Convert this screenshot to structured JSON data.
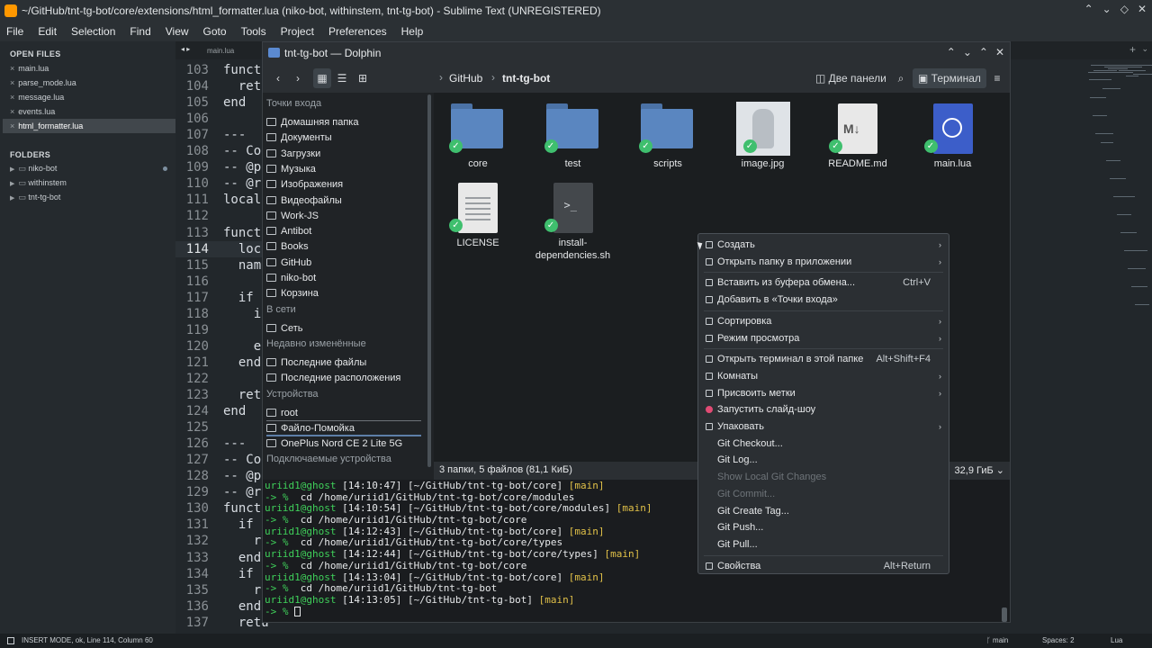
{
  "sublime": {
    "window_title": "~/GitHub/tnt-tg-bot/core/extensions/html_formatter.lua (niko-bot, withinstem, tnt-tg-bot) - Sublime Text (UNREGISTERED)",
    "menu": [
      "File",
      "Edit",
      "Selection",
      "Find",
      "View",
      "Goto",
      "Tools",
      "Project",
      "Preferences",
      "Help"
    ],
    "sidebar": {
      "open_files_title": "OPEN FILES",
      "open_files": [
        "main.lua",
        "parse_mode.lua",
        "message.lua",
        "events.lua",
        "html_formatter.lua"
      ],
      "folders_title": "FOLDERS",
      "folders": [
        "niko-bot",
        "withinstem",
        "tnt-tg-bot"
      ]
    },
    "tab": "main.lua",
    "code": [
      {
        "n": "103",
        "t": "functi"
      },
      {
        "n": "104",
        "t": "  retu"
      },
      {
        "n": "105",
        "t": "end"
      },
      {
        "n": "106",
        "t": ""
      },
      {
        "n": "107",
        "t": "---"
      },
      {
        "n": "108",
        "t": "-- Co"
      },
      {
        "n": "109",
        "t": "-- @pa"
      },
      {
        "n": "110",
        "t": "-- @re"
      },
      {
        "n": "111",
        "t": "local"
      },
      {
        "n": "112",
        "t": ""
      },
      {
        "n": "113",
        "t": "functi"
      },
      {
        "n": "114",
        "t": "  loca"
      },
      {
        "n": "115",
        "t": "  name"
      },
      {
        "n": "116",
        "t": ""
      },
      {
        "n": "117",
        "t": "  if c"
      },
      {
        "n": "118",
        "t": "    if"
      },
      {
        "n": "119",
        "t": ""
      },
      {
        "n": "120",
        "t": "    en"
      },
      {
        "n": "121",
        "t": "  end"
      },
      {
        "n": "122",
        "t": ""
      },
      {
        "n": "123",
        "t": "  retu"
      },
      {
        "n": "124",
        "t": "end"
      },
      {
        "n": "125",
        "t": ""
      },
      {
        "n": "126",
        "t": "---"
      },
      {
        "n": "127",
        "t": "-- Co"
      },
      {
        "n": "128",
        "t": "-- @pa"
      },
      {
        "n": "129",
        "t": "-- @re"
      },
      {
        "n": "130",
        "t": "functi"
      },
      {
        "n": "131",
        "t": "  if c"
      },
      {
        "n": "132",
        "t": "    re"
      },
      {
        "n": "133",
        "t": "  end"
      },
      {
        "n": "134",
        "t": "  if ("
      },
      {
        "n": "135",
        "t": "    re"
      },
      {
        "n": "136",
        "t": "  end"
      },
      {
        "n": "137",
        "t": "  retu"
      }
    ],
    "status": {
      "left": "INSERT MODE, ok, Line 114, Column 60",
      "branch": "main",
      "spaces": "Spaces: 2",
      "syntax": "Lua"
    }
  },
  "dolphin": {
    "title": "tnt-tg-bot — Dolphin",
    "breadcrumb": [
      "GitHub",
      "tnt-tg-bot"
    ],
    "toolbar": {
      "split": "Две панели",
      "terminal": "Терминал"
    },
    "places": [
      {
        "type": "group",
        "label": "Точки входа"
      },
      {
        "type": "item",
        "label": "Домашняя папка"
      },
      {
        "type": "item",
        "label": "Документы"
      },
      {
        "type": "item",
        "label": "Загрузки"
      },
      {
        "type": "item",
        "label": "Музыка"
      },
      {
        "type": "item",
        "label": "Изображения"
      },
      {
        "type": "item",
        "label": "Видеофайлы"
      },
      {
        "type": "item",
        "label": "Work-JS"
      },
      {
        "type": "item",
        "label": "Antibot"
      },
      {
        "type": "item",
        "label": "Books"
      },
      {
        "type": "item",
        "label": "GitHub"
      },
      {
        "type": "item",
        "label": "niko-bot"
      },
      {
        "type": "item",
        "label": "Корзина"
      },
      {
        "type": "group",
        "label": "В сети"
      },
      {
        "type": "item",
        "label": "Сеть"
      },
      {
        "type": "group",
        "label": "Недавно изменённые"
      },
      {
        "type": "item",
        "label": "Последние файлы"
      },
      {
        "type": "item",
        "label": "Последние расположения"
      },
      {
        "type": "group",
        "label": "Устройства"
      },
      {
        "type": "item",
        "label": "root"
      },
      {
        "type": "item",
        "label": "Файло-Помойка"
      },
      {
        "type": "item",
        "label": "OnePlus Nord CE 2 Lite 5G"
      },
      {
        "type": "group",
        "label": "Подключаемые устройства"
      }
    ],
    "files": [
      {
        "name": "core",
        "kind": "folder"
      },
      {
        "name": "test",
        "kind": "folder"
      },
      {
        "name": "scripts",
        "kind": "folder"
      },
      {
        "name": "image.jpg",
        "kind": "image"
      },
      {
        "name": "README.md",
        "kind": "markdown"
      },
      {
        "name": "main.lua",
        "kind": "lua"
      },
      {
        "name": "LICENSE",
        "kind": "text"
      },
      {
        "name": "install-dependencies.sh",
        "kind": "script"
      }
    ],
    "status": {
      "count": "3 папки, 5 файлов (81,1 КиБ)",
      "free": "32,9 ГиБ"
    },
    "terminal": [
      [
        {
          "c": "g",
          "t": "uriid1@ghost "
        },
        {
          "c": "w",
          "t": "[14:10:47] [~/GitHub/tnt-tg-bot/core] "
        },
        {
          "c": "y",
          "t": "[main]"
        }
      ],
      [
        {
          "c": "g",
          "t": "-> % "
        },
        {
          "c": "w",
          "t": " cd /home/uriid1/GitHub/tnt-tg-bot/core/modules"
        }
      ],
      [
        {
          "c": "g",
          "t": "uriid1@ghost "
        },
        {
          "c": "w",
          "t": "[14:10:54] [~/GitHub/tnt-tg-bot/core/modules] "
        },
        {
          "c": "y",
          "t": "[main]"
        }
      ],
      [
        {
          "c": "g",
          "t": "-> % "
        },
        {
          "c": "w",
          "t": " cd /home/uriid1/GitHub/tnt-tg-bot/core"
        }
      ],
      [
        {
          "c": "g",
          "t": "uriid1@ghost "
        },
        {
          "c": "w",
          "t": "[14:12:43] [~/GitHub/tnt-tg-bot/core] "
        },
        {
          "c": "y",
          "t": "[main]"
        }
      ],
      [
        {
          "c": "g",
          "t": "-> % "
        },
        {
          "c": "w",
          "t": " cd /home/uriid1/GitHub/tnt-tg-bot/core/types"
        }
      ],
      [
        {
          "c": "g",
          "t": "uriid1@ghost "
        },
        {
          "c": "w",
          "t": "[14:12:44] [~/GitHub/tnt-tg-bot/core/types] "
        },
        {
          "c": "y",
          "t": "[main]"
        }
      ],
      [
        {
          "c": "g",
          "t": "-> % "
        },
        {
          "c": "w",
          "t": " cd /home/uriid1/GitHub/tnt-tg-bot/core"
        }
      ],
      [
        {
          "c": "g",
          "t": "uriid1@ghost "
        },
        {
          "c": "w",
          "t": "[14:13:04] [~/GitHub/tnt-tg-bot/core] "
        },
        {
          "c": "y",
          "t": "[main]"
        }
      ],
      [
        {
          "c": "g",
          "t": "-> % "
        },
        {
          "c": "w",
          "t": " cd /home/uriid1/GitHub/tnt-tg-bot"
        }
      ],
      [
        {
          "c": "g",
          "t": "uriid1@ghost "
        },
        {
          "c": "w",
          "t": "[14:13:05] [~/GitHub/tnt-tg-bot] "
        },
        {
          "c": "y",
          "t": "[main]"
        }
      ],
      [
        {
          "c": "g",
          "t": "-> % "
        }
      ]
    ]
  },
  "context_menu": [
    {
      "label": "Создать",
      "submenu": true
    },
    {
      "label": "Открыть папку в приложении",
      "submenu": true
    },
    {
      "sep": true
    },
    {
      "label": "Вставить из буфера обмена...",
      "shortcut": "Ctrl+V"
    },
    {
      "label": "Добавить в «Точки входа»"
    },
    {
      "sep": true
    },
    {
      "label": "Сортировка",
      "submenu": true
    },
    {
      "label": "Режим просмотра",
      "submenu": true
    },
    {
      "sep": true
    },
    {
      "label": "Открыть терминал в этой папке",
      "shortcut": "Alt+Shift+F4"
    },
    {
      "label": "Комнаты",
      "submenu": true
    },
    {
      "label": "Присвоить метки",
      "submenu": true
    },
    {
      "label": "Запустить слайд-шоу",
      "icon": "red"
    },
    {
      "label": "Упаковать",
      "submenu": true
    },
    {
      "label": "Git Checkout...",
      "noicon": true
    },
    {
      "label": "Git Log...",
      "noicon": true
    },
    {
      "label": "Show Local Git Changes",
      "noicon": true,
      "disabled": true
    },
    {
      "label": "Git Commit...",
      "noicon": true,
      "disabled": true
    },
    {
      "label": "Git Create Tag...",
      "noicon": true
    },
    {
      "label": "Git Push...",
      "noicon": true
    },
    {
      "label": "Git Pull...",
      "noicon": true
    },
    {
      "sep": true
    },
    {
      "label": "Свойства",
      "shortcut": "Alt+Return"
    }
  ]
}
